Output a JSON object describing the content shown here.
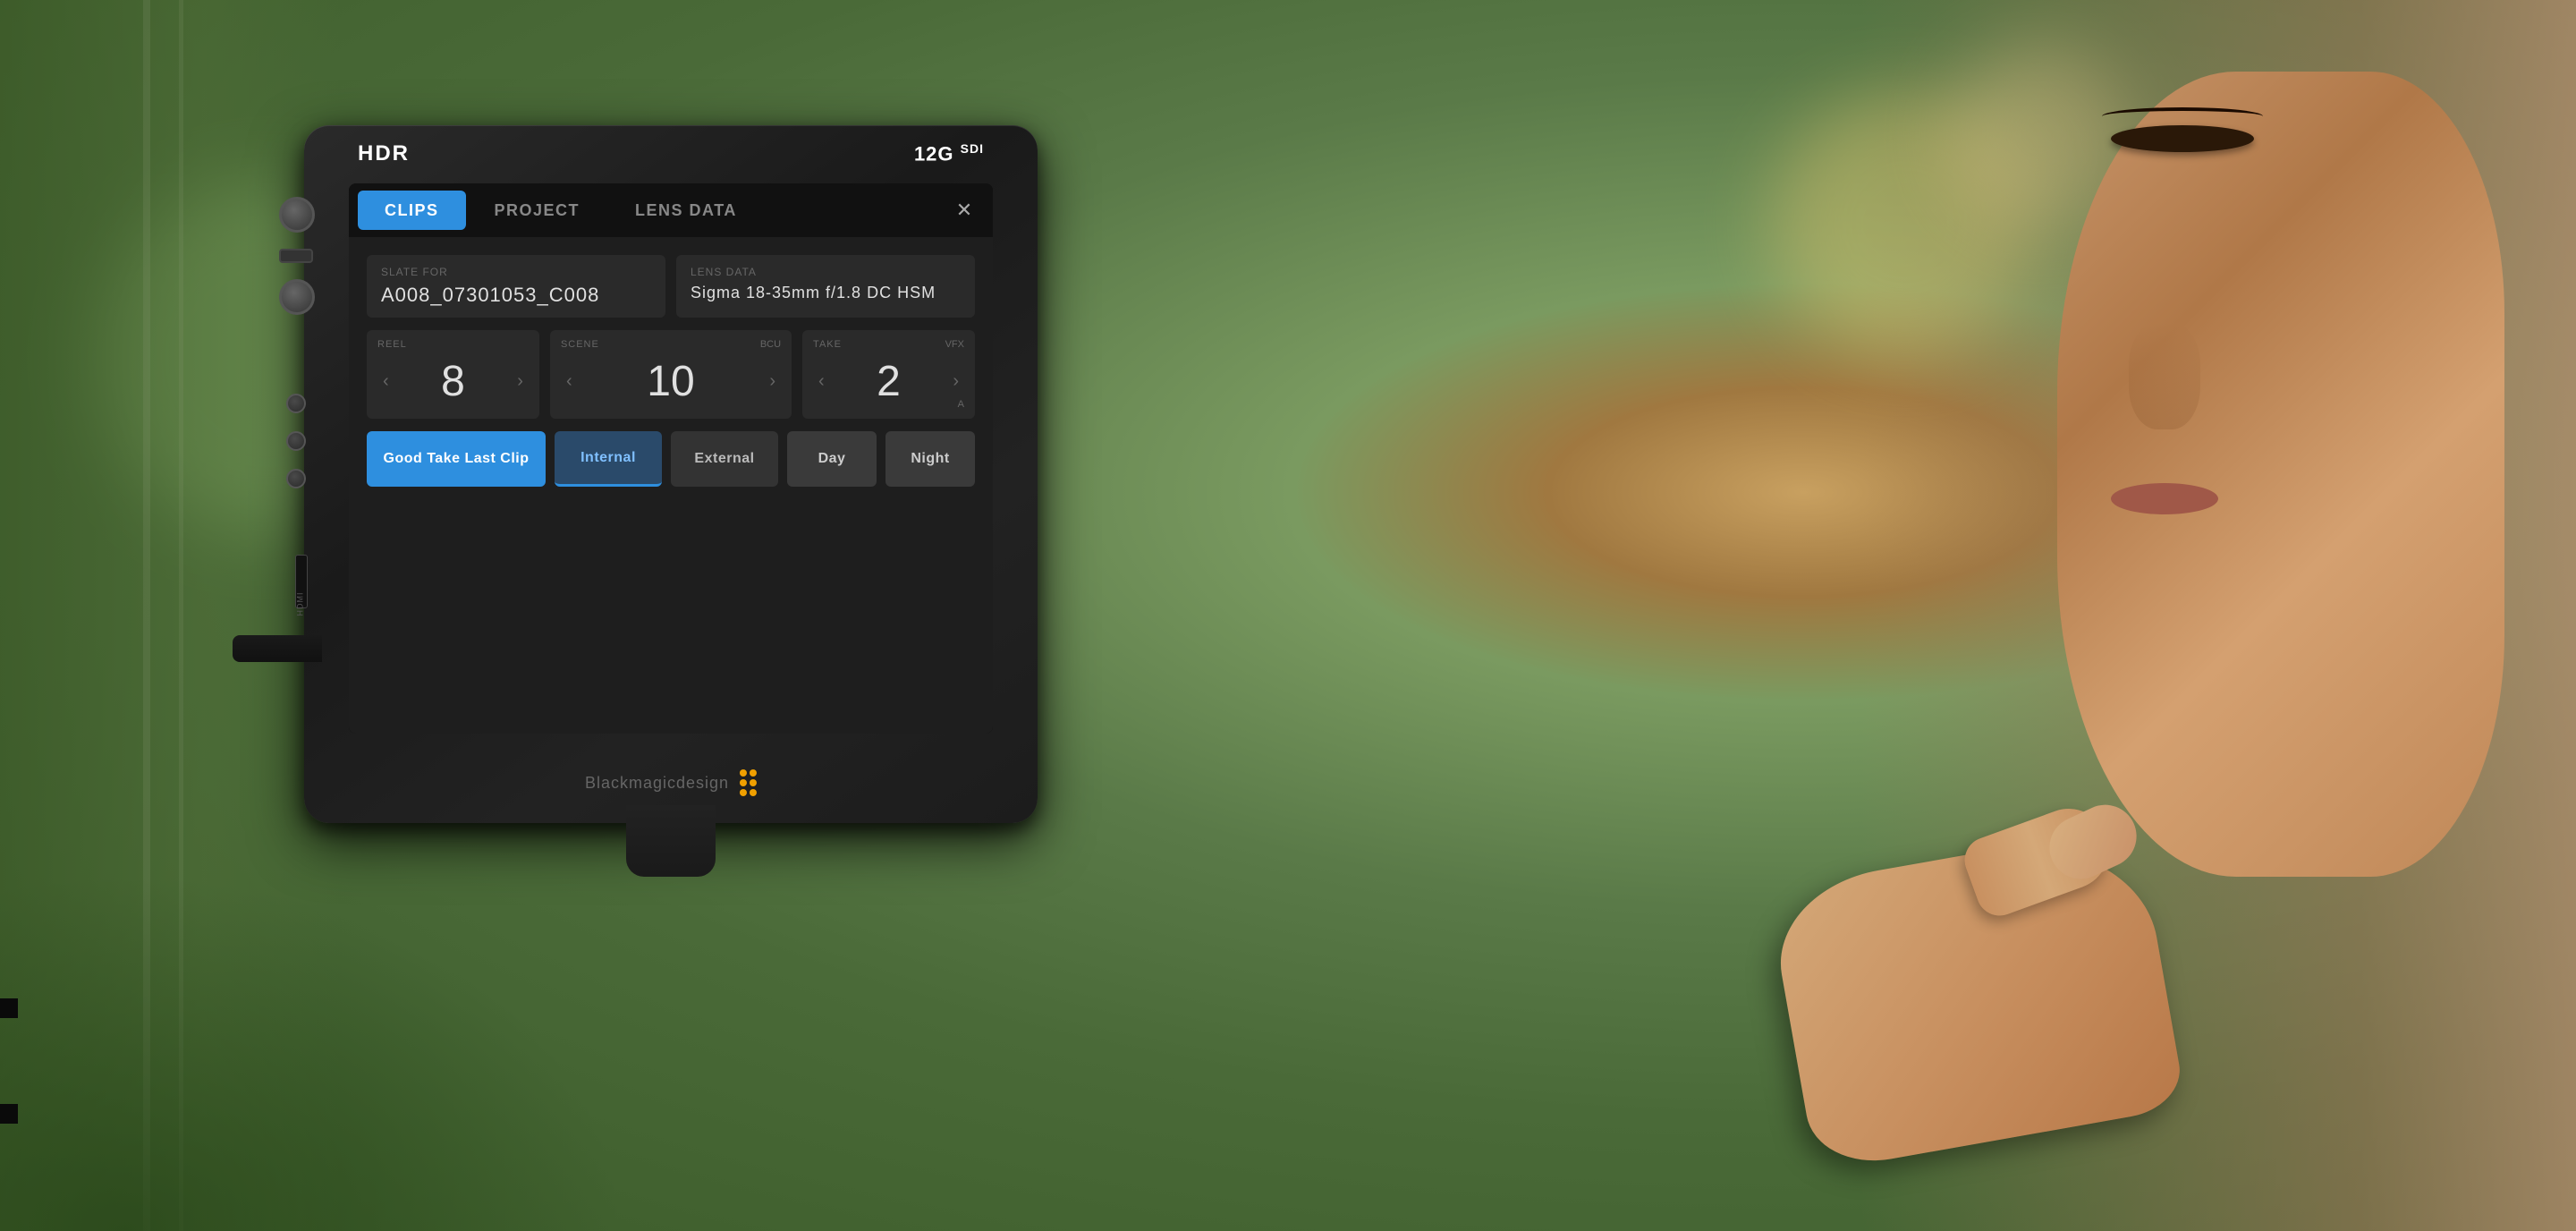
{
  "background": {
    "colors": {
      "primary": "#6a8a5a",
      "bokeh1": "#e8c870",
      "bokeh2": "#90b870"
    }
  },
  "device": {
    "hdr_badge": "HDR",
    "sdi_badge": "12G",
    "sdi_suffix": "SDI",
    "brand_name": "Blackmagicdesign",
    "hdmi_label": "HDMI"
  },
  "screen": {
    "tabs": [
      {
        "id": "clips",
        "label": "CLIPS",
        "active": true
      },
      {
        "id": "project",
        "label": "PROJECT",
        "active": false
      },
      {
        "id": "lens_data",
        "label": "LENS DATA",
        "active": false
      }
    ],
    "close_label": "✕",
    "slate_for_label": "SLATE FOR",
    "slate_value": "A008_07301053_C008",
    "lens_data_label": "LENS DATA",
    "lens_data_value": "Sigma 18-35mm f/1.8 DC HSM",
    "reel_label": "REEL",
    "reel_value": "8",
    "scene_label": "SCENE",
    "scene_value": "10",
    "bcu_label": "BCU",
    "take_label": "TAKE",
    "take_value": "2",
    "vfx_label": "VFX",
    "a_label": "A",
    "buttons": [
      {
        "id": "good_take",
        "label": "Good Take Last Clip",
        "style": "blue"
      },
      {
        "id": "internal",
        "label": "Internal",
        "style": "dark_active"
      },
      {
        "id": "external",
        "label": "External",
        "style": "dark"
      },
      {
        "id": "day",
        "label": "Day",
        "style": "medium"
      },
      {
        "id": "night",
        "label": "Night",
        "style": "medium"
      }
    ],
    "arrow_left": "‹",
    "arrow_right": "›"
  }
}
